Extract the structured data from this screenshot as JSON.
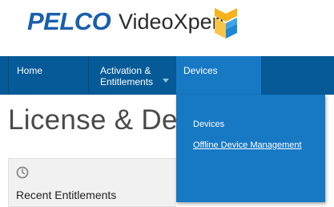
{
  "brand": {
    "company": "PELCO",
    "product": "VideoXpert",
    "logo_icon": "videoxpert-logo-mark",
    "colors": {
      "pelco_blue": "#1a5fae",
      "mark_yellow": "#f5b21b",
      "mark_blue": "#1e88d6"
    }
  },
  "nav": {
    "items": [
      {
        "label": "Home"
      },
      {
        "label": "Activation &",
        "label_line2": "Entitlements",
        "has_caret": true
      },
      {
        "label": "Devices",
        "active": true
      }
    ],
    "colors": {
      "bar": "#055a97",
      "active": "#1779c4"
    }
  },
  "dropdown": {
    "items": [
      {
        "label": "Devices"
      },
      {
        "label": "Offline Device Management"
      }
    ]
  },
  "page": {
    "title": "License & Del"
  },
  "panel": {
    "icon": "clock-icon",
    "title": "Recent Entitlements"
  }
}
